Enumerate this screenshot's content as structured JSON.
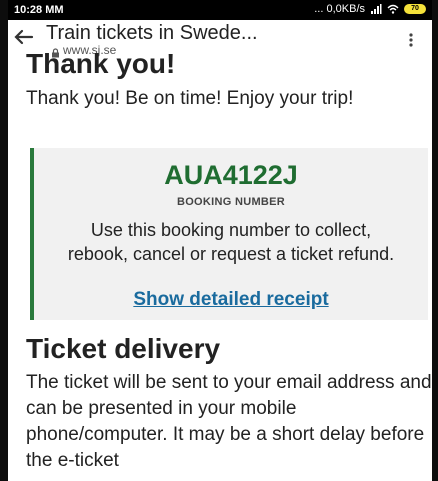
{
  "status_bar": {
    "time": "10:28 MM",
    "network_speed": "... 0,0KB/s",
    "battery_label": "70"
  },
  "browser": {
    "title": "Train tickets in Swede...",
    "url": "www.sj.se"
  },
  "content": {
    "heading": "Thank you!",
    "thank_text": "Thank you! Be on time! Enjoy your trip!",
    "booking": {
      "number": "AUA4122J",
      "label": "BOOKING NUMBER",
      "description": "Use this booking number to collect, rebook, cancel or request a ticket refund.",
      "receipt_link": "Show detailed receipt"
    },
    "delivery_heading": "Ticket delivery",
    "delivery_text": "The ticket will be sent to your email address and can be presented in your mobile phone/computer. It may be a short delay before the e-ticket"
  },
  "colors": {
    "accent_green": "#1f6d31",
    "link_blue": "#1a6b9e",
    "card_background": "#f1f1f1"
  },
  "icons": [
    "back-arrow-icon",
    "lock-icon",
    "more-vert-icon",
    "wifi-icon",
    "signal-icon",
    "battery-icon"
  ]
}
